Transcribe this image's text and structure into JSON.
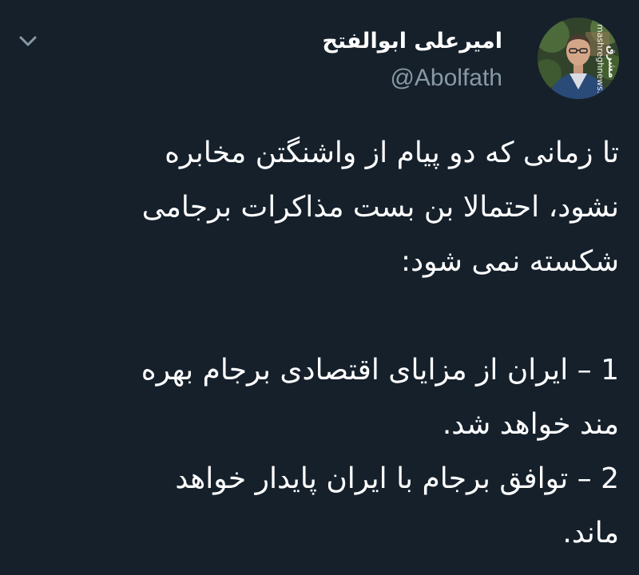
{
  "tweet": {
    "author": {
      "display_name": "امیرعلی ابوالفتح",
      "handle": "@Abolfath",
      "avatar_watermark_logo": "مشرق",
      "avatar_watermark_url": "mashreghnews.ir"
    },
    "body": {
      "para1": [
        "تا زمانی که دو پیام از واشنگتن مخابره",
        "نشود، احتمالا بن بست مذاکرات برجامی",
        "شکسته نمی شود:"
      ],
      "para2": [
        "1 – ایران از مزایای اقتصادی برجام بهره",
        "مند خواهد شد.",
        "2 – توافق برجام با ایران پایدار خواهد",
        "ماند."
      ]
    },
    "icons": {
      "menu": "chevron-down-icon",
      "avatar": "profile-photo"
    },
    "colors": {
      "background": "#15202b",
      "text": "#ffffff",
      "secondary": "#8899a6"
    }
  }
}
